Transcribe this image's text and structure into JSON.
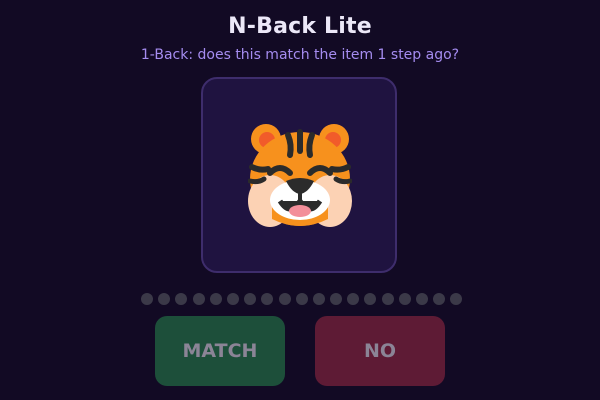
{
  "app": {
    "title": "N-Back Lite",
    "prompt": "1-Back: does this match the item 1 step ago?"
  },
  "stimulus": {
    "icon": "tiger-face-emoji"
  },
  "progress": {
    "total_steps": 19
  },
  "buttons": {
    "match_label": "MATCH",
    "no_label": "NO"
  },
  "colors": {
    "background": "#120a24",
    "card": "#1f1340",
    "card_border": "#3e2d6c",
    "accent_text": "#a58cf0",
    "match_button": "#1d4f3a",
    "no_button": "#5e1b35",
    "progress_dot": "#3b3948"
  }
}
